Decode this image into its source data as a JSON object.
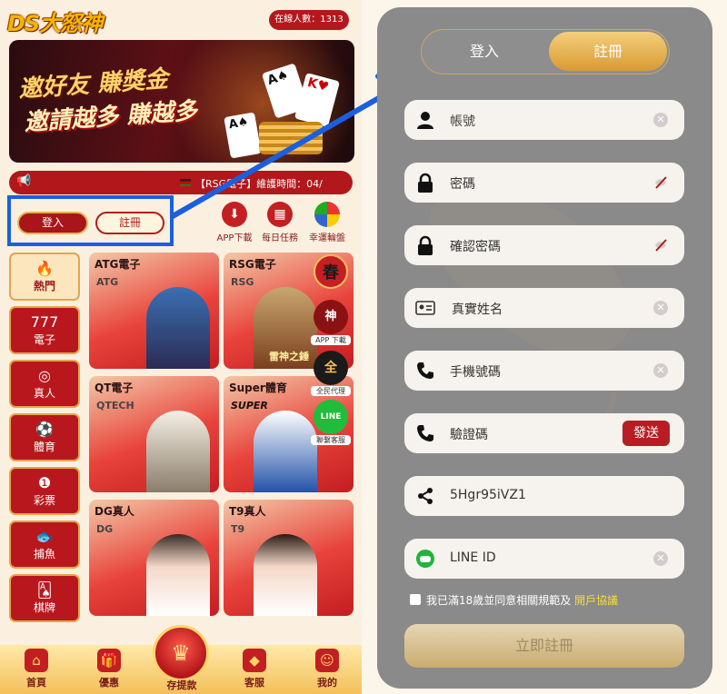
{
  "left": {
    "logo": "DS大怒神",
    "online_count": "在線人數：1313",
    "banner": {
      "line1": "邀好友 賺獎金",
      "line2": "邀請越多 賺越多",
      "card1": "A♠",
      "card2": "K♥",
      "card3": "A♠",
      "dot_count": 9
    },
    "marquee_text": "【RSG電子】維護時間：04/",
    "login_label": "登入",
    "register_label": "註冊",
    "quick_actions": [
      {
        "label": "APP下載",
        "icon": "download-icon"
      },
      {
        "label": "每日任務",
        "icon": "calendar-icon"
      },
      {
        "label": "幸運輪盤",
        "icon": "wheel-icon"
      }
    ],
    "sidebar": [
      {
        "label": "熱門",
        "icon": "fire-icon"
      },
      {
        "label": "電子",
        "icon": "slot-icon"
      },
      {
        "label": "真人",
        "icon": "chip-icon"
      },
      {
        "label": "體育",
        "icon": "soccer-icon"
      },
      {
        "label": "彩票",
        "icon": "lottery-icon"
      },
      {
        "label": "捕魚",
        "icon": "fish-icon"
      },
      {
        "label": "棋牌",
        "icon": "cards-icon"
      }
    ],
    "games": [
      {
        "title": "ATG電子",
        "mark": "ATG"
      },
      {
        "title": "RSG電子",
        "mark": "RSG",
        "badge": "雷神之錘"
      },
      {
        "title": "QT電子",
        "mark": "QTECH"
      },
      {
        "title": "Super體育",
        "mark": "SUPER"
      },
      {
        "title": "DG真人",
        "mark": "DG"
      },
      {
        "title": "T9真人",
        "mark": "T9"
      }
    ],
    "floating": [
      {
        "icon": "spring-icon",
        "glyph": "春",
        "label": ""
      },
      {
        "icon": "app-icon",
        "glyph": "神",
        "label": "APP 下載"
      },
      {
        "icon": "agent-icon",
        "glyph": "全",
        "label": "全民代理"
      },
      {
        "icon": "line-icon",
        "glyph": "LINE",
        "label": "聯繫客服"
      }
    ],
    "nav": [
      {
        "label": "首頁",
        "icon": "home-icon"
      },
      {
        "label": "優惠",
        "icon": "gift-icon"
      },
      {
        "label": "存提款",
        "icon": "wallet-icon"
      },
      {
        "label": "客服",
        "icon": "service-icon"
      },
      {
        "label": "我的",
        "icon": "profile-icon"
      }
    ]
  },
  "right": {
    "tab_login": "登入",
    "tab_register": "註冊",
    "fields": {
      "account": {
        "placeholder": "帳號",
        "icon": "user-icon"
      },
      "password": {
        "placeholder": "密碼",
        "icon": "lock-icon"
      },
      "confirm": {
        "placeholder": "確認密碼",
        "icon": "lock-icon"
      },
      "realname": {
        "placeholder": "真實姓名",
        "icon": "id-card-icon"
      },
      "phone": {
        "placeholder": "手機號碼",
        "icon": "phone-icon"
      },
      "code": {
        "placeholder": "驗證碼",
        "icon": "phone-icon"
      },
      "invite": {
        "value": "5Hgr95iVZ1",
        "icon": "share-icon"
      },
      "line": {
        "placeholder": "LINE ID",
        "icon": "line-icon"
      }
    },
    "send_label": "發送",
    "agree_text": "我已滿18歲並同意相關規範及",
    "agree_link": "開戶協議",
    "submit_label": "立即註冊"
  },
  "colors": {
    "brand_red": "#b4181c",
    "gold": "#e0a83f",
    "highlight_blue": "#1a5fe0",
    "panel_gray": "#8a8a8a"
  }
}
